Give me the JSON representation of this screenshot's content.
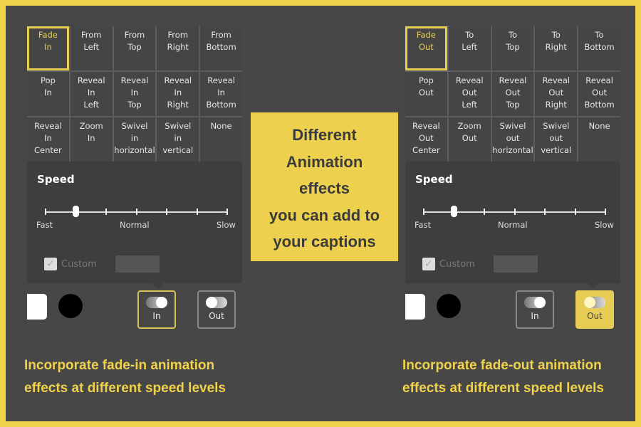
{
  "left": {
    "cells": [
      "Fade\nIn",
      "From\nLeft",
      "From\nTop",
      "From\nRight",
      "From\nBottom",
      "Pop\nIn",
      "Reveal\nIn\nLeft",
      "Reveal\nIn\nTop",
      "Reveal\nIn\nRight",
      "Reveal\nIn\nBottom",
      "Reveal\nIn\nCenter",
      "Zoom\nIn",
      "Swivel\nin\nhorizontal",
      "Swivel\nin\nvertical",
      "None"
    ],
    "selected": 0,
    "speed_title": "Speed",
    "fast": "Fast",
    "normal": "Normal",
    "slow": "Slow",
    "speed_level": 1,
    "custom": "Custom",
    "in": "In",
    "out": "Out",
    "active": "in",
    "caption": "Incorporate fade-in animation\neffects at different speed levels"
  },
  "right": {
    "cells": [
      "Fade\nOut",
      "To\nLeft",
      "To\nTop",
      "To\nRight",
      "To\nBottom",
      "Pop\nOut",
      "Reveal\nOut\nLeft",
      "Reveal\nOut\nTop",
      "Reveal\nOut\nRight",
      "Reveal\nOut\nBottom",
      "Reveal\nOut\nCenter",
      "Zoom\nOut",
      "Swivel\nout\nhorizontal",
      "Swivel\nout\nvertical",
      "None"
    ],
    "selected": 0,
    "speed_title": "Speed",
    "fast": "Fast",
    "normal": "Normal",
    "slow": "Slow",
    "speed_level": 1,
    "custom": "Custom",
    "in": "In",
    "out": "Out",
    "active": "out",
    "caption": "Incorporate fade-out animation\neffects at different speed levels"
  },
  "center": "Different\nAnimation\neffects\nyou can add to\nyour captions",
  "colors": {
    "accent": "#f0d24a",
    "background": "#474747"
  }
}
